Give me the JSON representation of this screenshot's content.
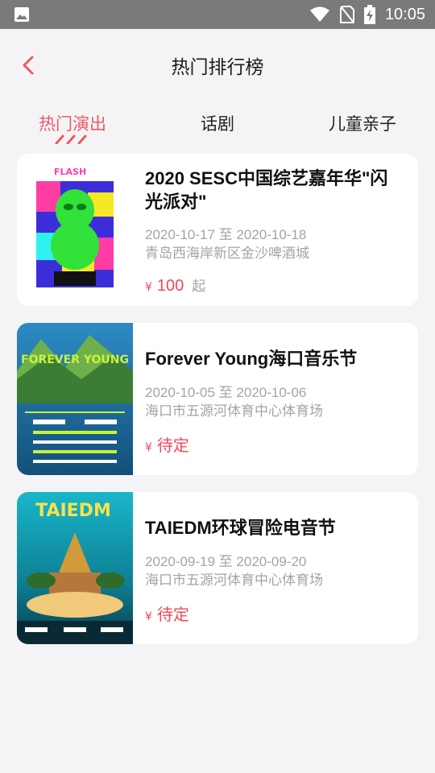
{
  "status_bar": {
    "time": "10:05"
  },
  "header": {
    "title": "热门排行榜"
  },
  "tabs": [
    {
      "label": "热门演出"
    },
    {
      "label": "话剧"
    },
    {
      "label": "儿童亲子"
    }
  ],
  "events": [
    {
      "title": "2020 SESC中国综艺嘉年华\"闪光派对\"",
      "dates": "2020-10-17 至 2020-10-18",
      "venue": "青岛西海岸新区金沙啤酒城",
      "price_symbol": "¥",
      "price": "100",
      "price_suffix": "起"
    },
    {
      "title": "Forever Young海口音乐节",
      "dates": "2020-10-05 至 2020-10-06",
      "venue": "海口市五源河体育中心体育场",
      "price_symbol": "¥",
      "price": "待定",
      "price_suffix": ""
    },
    {
      "title": "TAIEDM环球冒险电音节",
      "dates": "2020-09-19 至 2020-09-20",
      "venue": "海口市五源河体育中心体育场",
      "price_symbol": "¥",
      "price": "待定",
      "price_suffix": ""
    }
  ],
  "posters": {
    "poster1_text": "FLASH",
    "poster2_text": "FOREVER YOUNG",
    "poster3_text": "TAIEDM"
  },
  "colors": {
    "accent": "#f25766",
    "price": "#f2495c",
    "statusbar": "#7a7a7a",
    "background": "#f4f4f6"
  }
}
